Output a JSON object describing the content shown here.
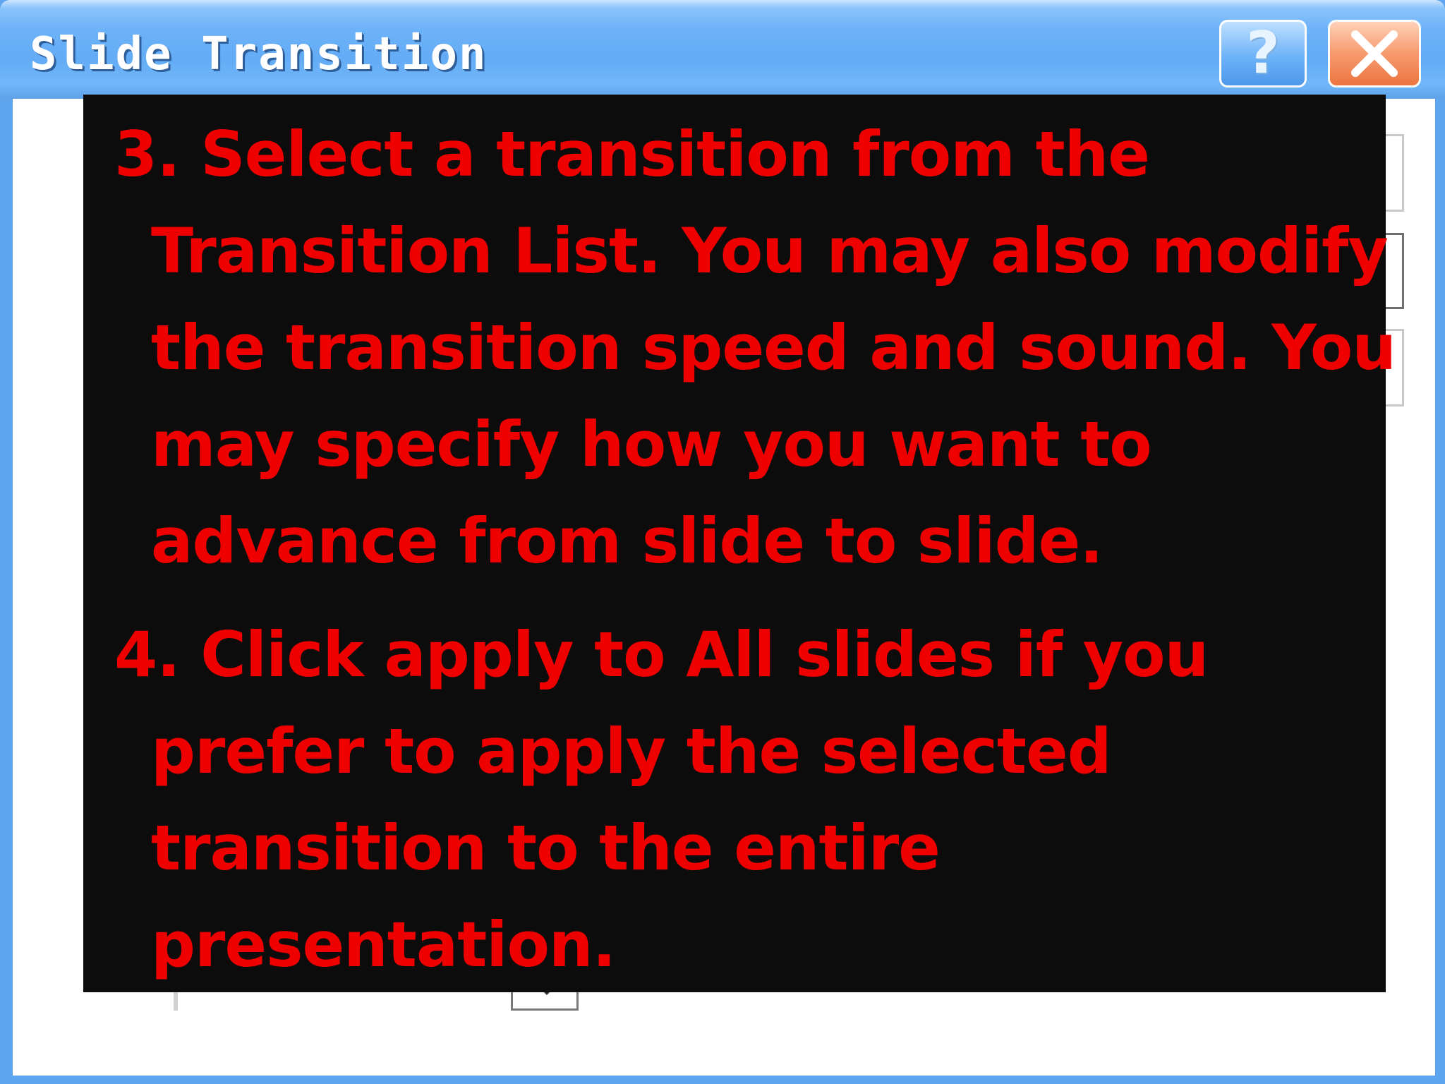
{
  "window": {
    "title": "Slide Transition",
    "help_button_label": "?",
    "close_icon": "close-icon"
  },
  "instructions": {
    "step3": {
      "lines": [
        "3. Select a transition from the",
        "Transition List. You may also modify",
        "the transition speed and sound. You",
        "may specify how you want to",
        "advance from slide to slide."
      ]
    },
    "step4": {
      "lines": [
        "4. Click apply to All slides if you",
        "prefer to apply the selected",
        "transition to the entire",
        "presentation."
      ]
    }
  },
  "colors": {
    "title_bar": "#63acf6",
    "overlay_background": "#0c0c0c",
    "instruction_text": "#ee0000",
    "close_button": "#ec7541"
  }
}
